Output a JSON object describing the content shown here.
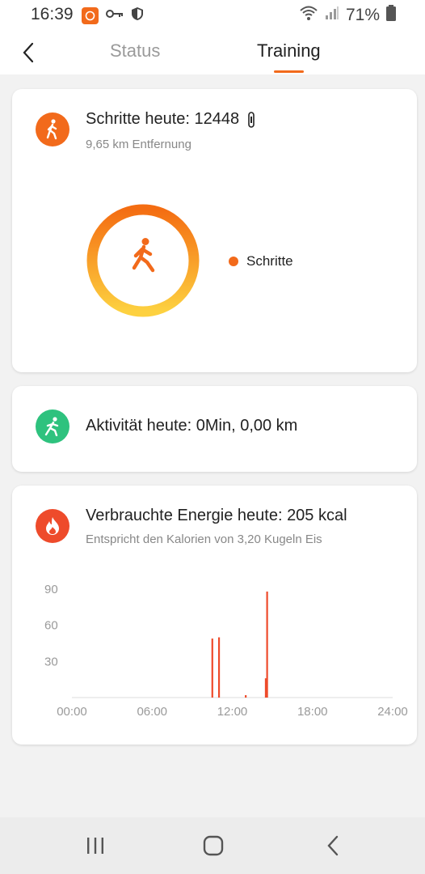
{
  "status_bar": {
    "time": "16:39",
    "battery": "71%",
    "icons": [
      "app-notification-icon",
      "vpn-key-icon",
      "shield-icon",
      "wifi-icon",
      "signal-icon",
      "battery-icon"
    ]
  },
  "header": {
    "back_icon": "chevron-left-icon",
    "tabs": [
      {
        "label": "Status",
        "active": false
      },
      {
        "label": "Training",
        "active": true
      }
    ]
  },
  "steps_card": {
    "title": "Schritte heute: 12448",
    "subtitle": "9,65 km Entfernung",
    "icon": "walking-icon",
    "device_icon": "band-device-icon",
    "legend_label": "Schritte",
    "accent_color": "#f26a1b"
  },
  "activity_card": {
    "title": "Aktivität heute: 0Min, 0,00 km",
    "icon": "running-icon",
    "accent_color": "#2ec27e"
  },
  "energy_card": {
    "title": "Verbrauchte Energie heute: 205 kcal",
    "subtitle": "Entspricht den Kalorien von 3,20 Kugeln Eis",
    "icon": "flame-icon",
    "accent_color": "#ee4b2b"
  },
  "chart_data": {
    "type": "bar",
    "title": "",
    "xlabel": "",
    "ylabel": "",
    "x_ticks": [
      "00:00",
      "06:00",
      "12:00",
      "18:00",
      "24:00"
    ],
    "y_ticks": [
      "30",
      "60",
      "90"
    ],
    "xlim": [
      0,
      24
    ],
    "ylim": [
      0,
      90
    ],
    "grid": false,
    "bar_color": "#ee4b2b",
    "x": [
      10.5,
      11.0,
      13.0,
      14.5,
      14.6
    ],
    "values": [
      49,
      50,
      2,
      16,
      88
    ]
  },
  "nav_bar": {
    "icons": [
      "recent-apps-icon",
      "home-icon",
      "back-icon"
    ]
  }
}
